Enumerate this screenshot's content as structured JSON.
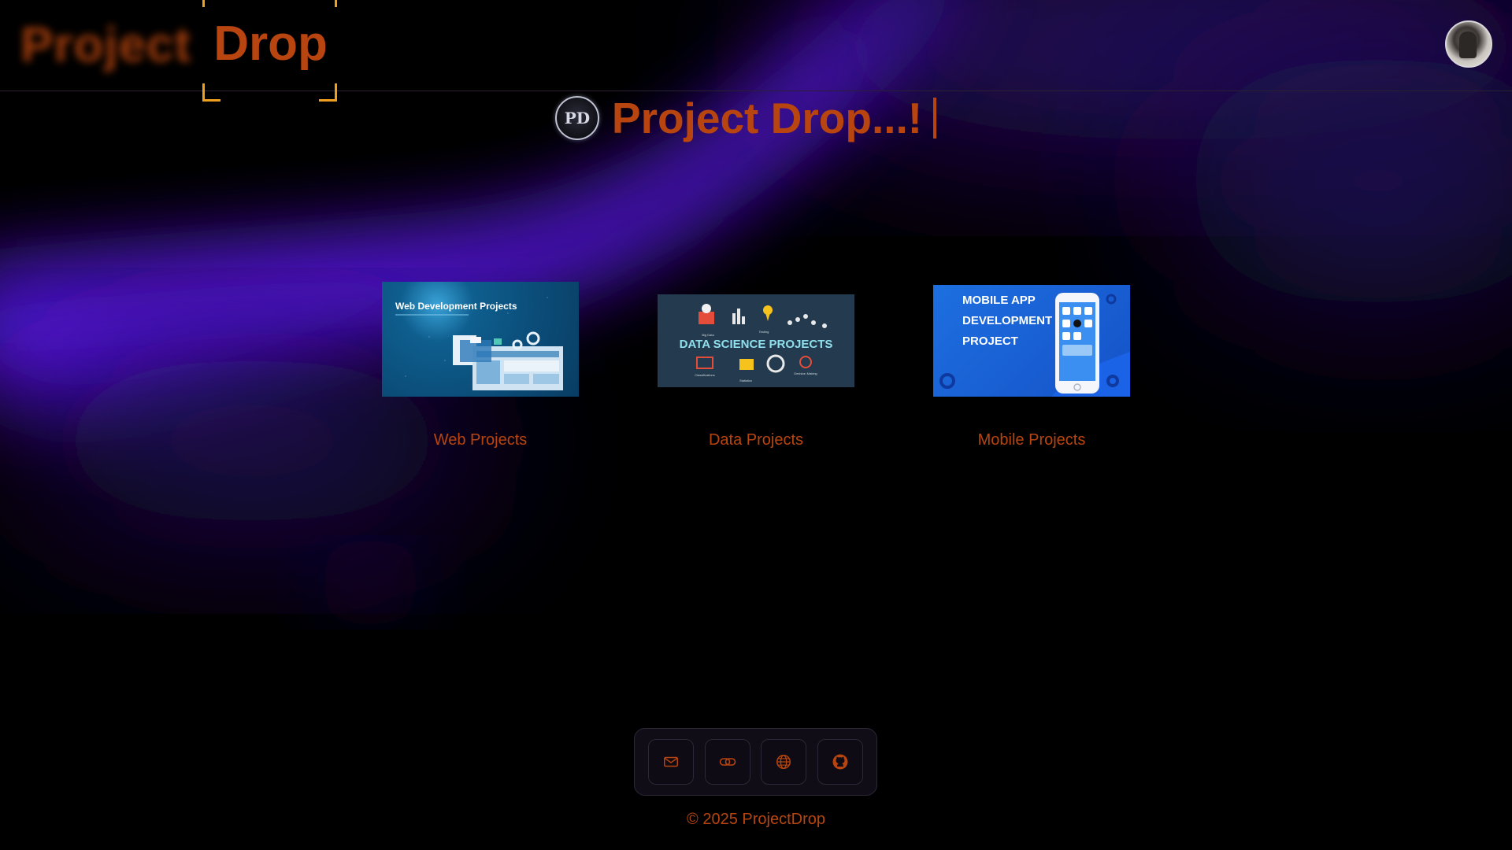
{
  "header": {
    "logo_word1": "Project",
    "logo_word2": "Drop",
    "avatar_alt": "User avatar"
  },
  "hero": {
    "logo_mark": "PD",
    "title": "Project Drop...!"
  },
  "cards": [
    {
      "label": "Web Projects",
      "image_text": "Web Development Projects"
    },
    {
      "label": "Data Projects",
      "image_text": "DATA SCIENCE PROJECTS",
      "image_captions": [
        "Big Data",
        "Testing",
        "Classifications",
        "Statistics",
        "Decision Making"
      ]
    },
    {
      "label": "Mobile Projects",
      "image_text_lines": [
        "MOBILE APP",
        "DEVELOPMENT",
        "PROJECT"
      ]
    }
  ],
  "social": {
    "icons": [
      "mail-icon",
      "link-icon",
      "globe-icon",
      "github-icon"
    ]
  },
  "footer": {
    "copyright": "© 2025 ProjectDrop"
  },
  "colors": {
    "accent": "#b8450f",
    "corner": "#f0a020",
    "glow": "#5a18e0",
    "background": "#000000"
  }
}
